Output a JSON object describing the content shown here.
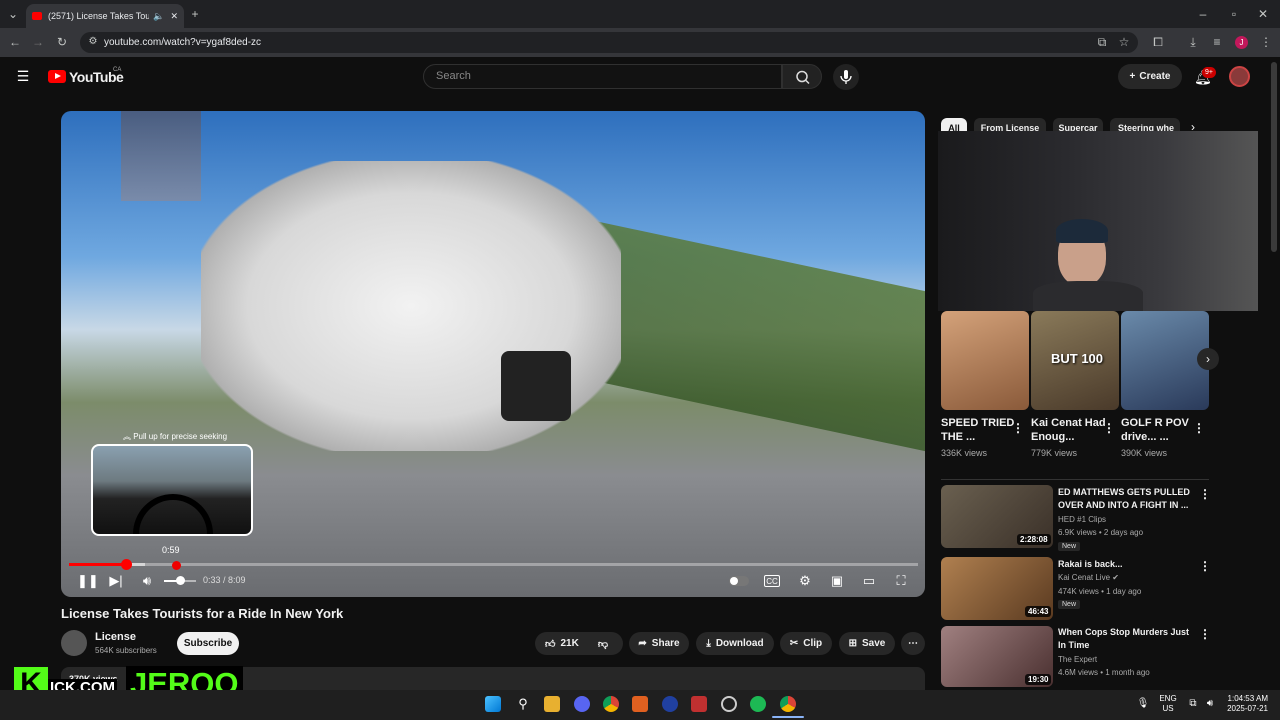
{
  "browser": {
    "tab_title": "(2571) License Takes Tourist",
    "url": "youtube.com/watch?v=ygaf8ded-zc"
  },
  "header": {
    "logo_text": "YouTube",
    "country": "CA",
    "search_placeholder": "Search",
    "create_label": "Create",
    "notification_count": "9+"
  },
  "player": {
    "seek_hint": "Pull up for precise seeking",
    "hover_time": "0:59",
    "current_time": "0:33 / 8:09",
    "played_fraction": 0.067,
    "buffered_fraction": 0.09,
    "volume_fraction": 0.5
  },
  "video": {
    "title": "License Takes Tourists for a Ride In New York",
    "channel": "License",
    "subscribers": "564K subscribers",
    "subscribe_label": "Subscribe",
    "likes": "21K",
    "share_label": "Share",
    "download_label": "Download",
    "clip_label": "Clip",
    "save_label": "Save",
    "views_partial": "370K views"
  },
  "chips": [
    "All",
    "From License",
    "Supercar",
    "Steering whe"
  ],
  "shorts": [
    {
      "title": "SPEED TRIED THE ...",
      "views": "336K views",
      "color": "#b87a5a"
    },
    {
      "title": "Kai Cenat Had Enoug...",
      "views": "779K views",
      "color": "#7a6a4a",
      "overlay": "BUT 100"
    },
    {
      "title": "GOLF R POV drive... ...",
      "views": "390K views",
      "color": "#3a4e6a"
    }
  ],
  "recommended": [
    {
      "title": "ED MATTHEWS GETS PULLED OVER AND INTO A FIGHT IN ...",
      "channel": "HED #1 Clips",
      "meta": "6.9K views • 2 days ago",
      "duration": "2:28:08",
      "badge": "New",
      "color": "#5a5040"
    },
    {
      "title": "Rakai is back...",
      "channel": "Kai Cenat Live",
      "meta": "474K views • 1 day ago",
      "duration": "46:43",
      "badge": "New",
      "color": "#8a6040"
    },
    {
      "title": "When Cops Stop Murders Just In Time",
      "channel": "The Expert",
      "meta": "4.6M views • 1 month ago",
      "duration": "19:30",
      "badge": "",
      "color": "#7a5a5a"
    }
  ],
  "watermark": {
    "k": "K",
    "site": "ICK.COM",
    "streamer": "JERQO"
  },
  "taskbar": {
    "lang_top": "ENG",
    "lang_bottom": "US",
    "time": "1:04:53 AM",
    "date": "2025-07-21"
  },
  "colors": {
    "accent": "#ff0000",
    "kick_green": "#53fc18"
  }
}
